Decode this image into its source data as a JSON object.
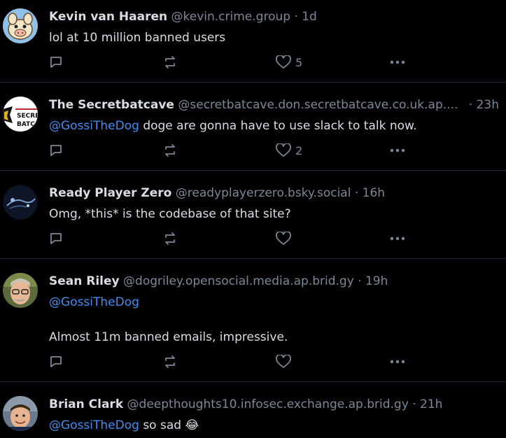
{
  "posts": [
    {
      "name": "Kevin van Haaren",
      "handle": "@kevin.crime.group",
      "time": "· 1d",
      "text": "lol at 10 million banned users",
      "likes": "5"
    },
    {
      "name": "The Secretbatcave",
      "handle": "@secretbatcave.don.secretbatcave.co.uk.ap....",
      "time": "· 23h",
      "mention": "@GossiTheDog",
      "text": " doge are gonna have to use slack to talk now.",
      "likes": "2",
      "avatar_text_1": "SECRE",
      "avatar_text_2": "BATCA"
    },
    {
      "name": "Ready Player Zero",
      "handle": "@readyplayerzero.bsky.social",
      "time": "· 16h",
      "text": "Omg, *this* is the codebase of that site?",
      "likes": ""
    },
    {
      "name": "Sean Riley",
      "handle": "@dogriley.opensocial.media.ap.brid.gy",
      "time": "· 19h",
      "mention": "@GossiTheDog",
      "text2": "Almost 11m banned emails, impressive.",
      "likes": ""
    },
    {
      "name": "Brian Clark",
      "handle": "@deepthoughts10.infosec.exchange.ap.brid.gy",
      "time": "· 21h",
      "mention": "@GossiTheDog",
      "text": " so sad 😂"
    }
  ],
  "icons": {
    "reply": "reply-icon",
    "repost": "repost-icon",
    "like": "heart-icon",
    "more": "more-icon"
  },
  "colors": {
    "background": "#000000",
    "text": "#d9dde3",
    "muted": "#7b8896",
    "mention": "#3c8ff0",
    "divider": "#1f2a36"
  }
}
